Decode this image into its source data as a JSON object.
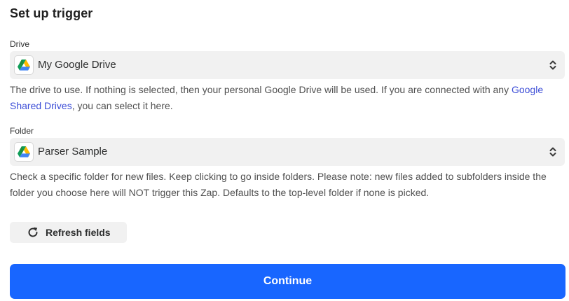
{
  "header": {
    "title": "Set up trigger"
  },
  "drive_field": {
    "label": "Drive",
    "value": "My Google Drive",
    "icon": "google-drive-icon",
    "help_before_link": "The drive to use. If nothing is selected, then your personal Google Drive will be used. If you are connected with any ",
    "help_link": "Google Shared Drives",
    "help_after_link": ", you can select it here."
  },
  "folder_field": {
    "label": "Folder",
    "value": "Parser Sample",
    "icon": "google-drive-icon",
    "help": "Check a specific folder for new files. Keep clicking to go inside folders. Please note: new files added to subfolders inside the folder you choose here will NOT trigger this Zap. Defaults to the top-level folder if none is picked."
  },
  "actions": {
    "refresh_label": "Refresh fields",
    "continue_label": "Continue"
  },
  "colors": {
    "primary": "#1866ff",
    "link": "#3d4ed7",
    "field_bg": "#f1f1f1"
  }
}
